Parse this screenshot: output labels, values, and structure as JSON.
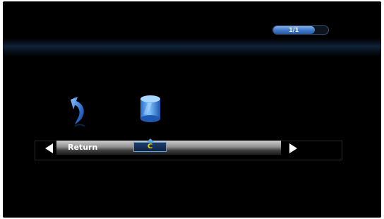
{
  "pager": {
    "text": "1/1",
    "progress": 0.75
  },
  "items": [
    {
      "label": "Return",
      "icon": "return-arrow-icon"
    },
    {
      "label": "C",
      "icon": "drive-icon",
      "selected": true
    }
  ],
  "colors": {
    "screen_bg": "#000000",
    "accent_blue": "#3f78c8",
    "selected_label": "#f5d000",
    "nav_arrow": "#ffffff"
  }
}
